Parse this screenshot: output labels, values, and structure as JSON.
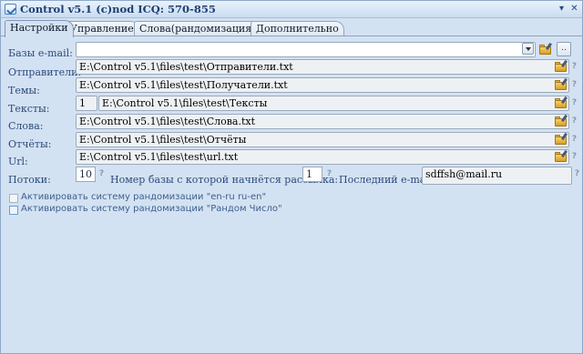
{
  "window": {
    "title": "Control v5.1 (c)nod  ICQ: 570-855",
    "minimize": "▾",
    "close": "✕"
  },
  "tabs": [
    {
      "label": "Настройки",
      "active": true
    },
    {
      "label": "Управление",
      "active": false
    },
    {
      "label": "Слова(рандомизация)",
      "active": false
    },
    {
      "label": "Дополнительно",
      "active": false
    }
  ],
  "form": {
    "email_bases_label": "Базы e-mail:",
    "email_bases_value": "",
    "email_bases_add": "..",
    "senders_label": "Отправители:",
    "senders_value": "E:\\Control v5.1\\files\\test\\Отправители.txt",
    "topics_label": "Темы:",
    "topics_value": "E:\\Control v5.1\\files\\test\\Получатели.txt",
    "texts_label": "Тексты:",
    "texts_count": "1",
    "texts_value": "E:\\Control v5.1\\files\\test\\Тексты",
    "words_label": "Слова:",
    "words_value": "E:\\Control v5.1\\files\\test\\Слова.txt",
    "reports_label": "Отчёты:",
    "reports_value": "E:\\Control v5.1\\files\\test\\Отчёты",
    "url_label": "Url:",
    "url_value": "E:\\Control v5.1\\files\\test\\url.txt",
    "threads_label": "Потоки:",
    "threads_value": "10",
    "start_base_label": "Номер базы с которой начнётся рассылка:",
    "start_base_value": "1",
    "last_email_label": "Последний e-mail:",
    "last_email_value": "sdffsh@mail.ru",
    "help_glyph": "?"
  },
  "options": {
    "randomize_en_ru": "Активировать систему рандомизации \"en-ru ru-en\"",
    "randomize_number": "Активировать систему рандомизации \"Рандом Число\""
  },
  "icons": {
    "folder": "folder-open-icon",
    "help": "help-icon",
    "dropdown": "chevron-down-icon"
  }
}
